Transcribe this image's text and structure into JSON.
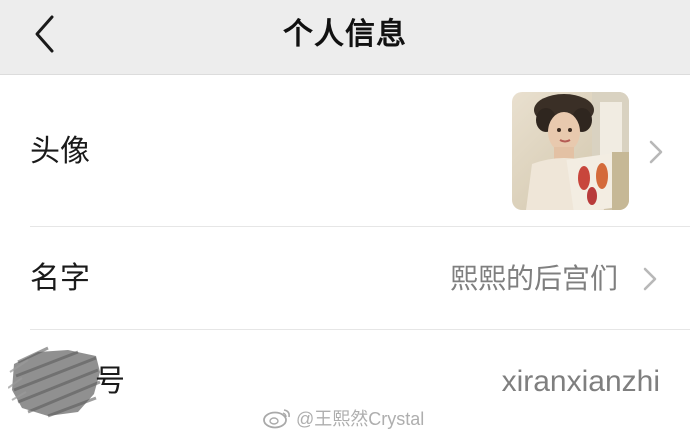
{
  "header": {
    "title": "个人信息",
    "back_icon": "chevron-left-icon"
  },
  "rows": [
    {
      "label": "头像",
      "value_type": "avatar",
      "chevron": "chevron-right-icon"
    },
    {
      "label": "名字",
      "value": "熙熙的后宫们",
      "chevron": "chevron-right-icon"
    },
    {
      "label": "号",
      "value": "xiranxianzhi"
    }
  ],
  "watermark": {
    "text": "@王熙然Crystal",
    "icon": "weibo-icon"
  },
  "colors": {
    "nav_background": "#ededed",
    "value_text": "#7f7f7f",
    "chevron": "#b8b8b8",
    "divider": "#e6e6e6"
  }
}
